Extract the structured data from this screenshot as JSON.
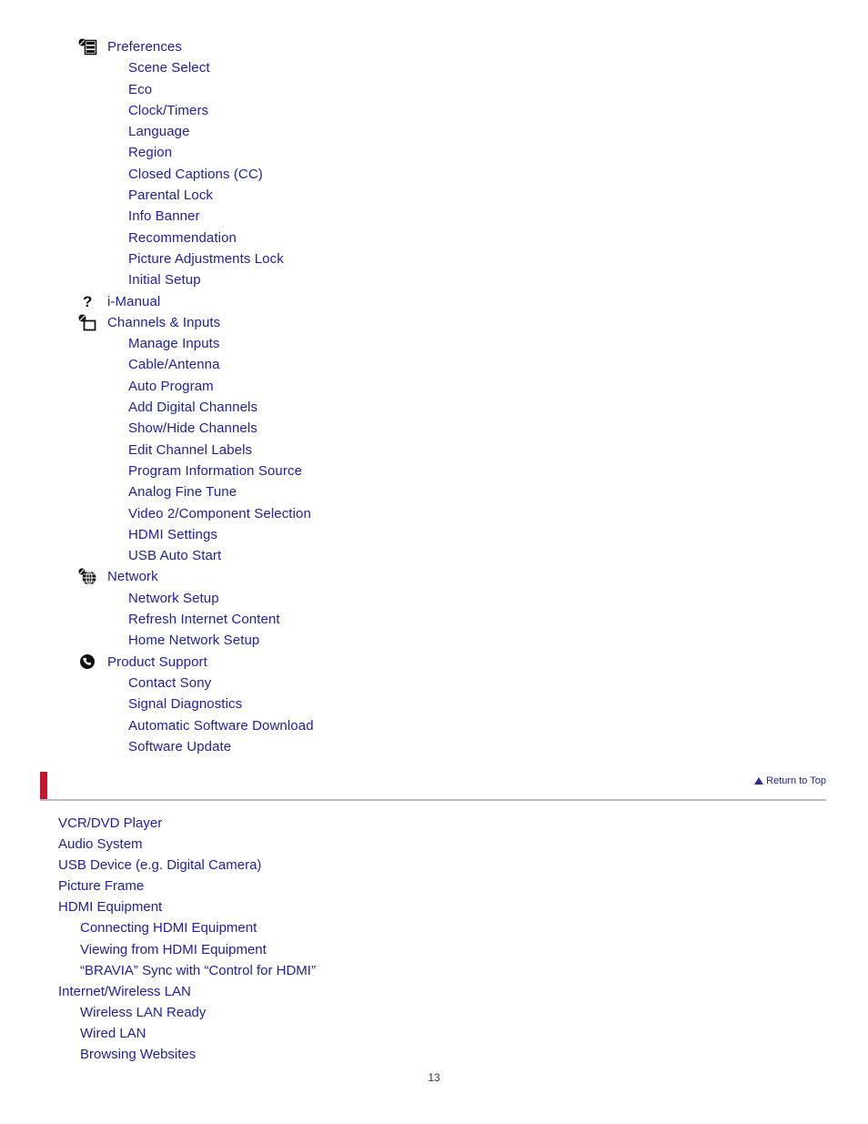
{
  "document": {
    "page_number": "13"
  },
  "toc": {
    "groups": [
      {
        "icon": "preferences-list-icon",
        "label": "Preferences",
        "items": [
          "Scene Select",
          "Eco",
          "Clock/Timers",
          "Language",
          "Region",
          "Closed Captions (CC)",
          "Parental Lock",
          "Info Banner",
          "Recommendation",
          "Picture Adjustments Lock",
          "Initial Setup"
        ]
      },
      {
        "icon": "question-mark-icon",
        "label": "i-Manual",
        "items": []
      },
      {
        "icon": "tv-input-icon",
        "label": "Channels & Inputs",
        "items": [
          "Manage Inputs",
          "Cable/Antenna",
          "Auto Program",
          "Add Digital Channels",
          "Show/Hide Channels",
          "Edit Channel Labels",
          "Program Information Source",
          "Analog Fine Tune",
          "Video 2/Component Selection",
          "HDMI Settings",
          "USB Auto Start"
        ]
      },
      {
        "icon": "globe-icon",
        "label": "Network",
        "items": [
          "Network Setup",
          "Refresh Internet Content",
          "Home Network Setup"
        ]
      },
      {
        "icon": "phone-icon",
        "label": "Product Support",
        "items": [
          "Contact Sony",
          "Signal Diagnostics",
          "Automatic Software Download",
          "Software Update"
        ]
      }
    ]
  },
  "divider": {
    "return_to_top_label": "Return to Top",
    "accent_color": "#c2152f",
    "rule_color": "#bdbdbd"
  },
  "lower_list": {
    "entries": [
      {
        "label": "VCR/DVD Player",
        "level": "top"
      },
      {
        "label": "Audio System",
        "level": "top"
      },
      {
        "label": "USB Device (e.g. Digital Camera)",
        "level": "top"
      },
      {
        "label": "Picture Frame",
        "level": "top"
      },
      {
        "label": "HDMI Equipment",
        "level": "top"
      },
      {
        "label": "Connecting HDMI Equipment",
        "level": "sub"
      },
      {
        "label": "Viewing from HDMI Equipment",
        "level": "sub"
      },
      {
        "label": "“BRAVIA” Sync with “Control for HDMI”",
        "level": "sub"
      },
      {
        "label": "Internet/Wireless LAN",
        "level": "top"
      },
      {
        "label": "Wireless LAN Ready",
        "level": "sub"
      },
      {
        "label": "Wired LAN",
        "level": "sub"
      },
      {
        "label": "Browsing Websites",
        "level": "sub"
      }
    ]
  },
  "colors": {
    "link_text": "#2020a8",
    "page_number_text": "#333333"
  }
}
